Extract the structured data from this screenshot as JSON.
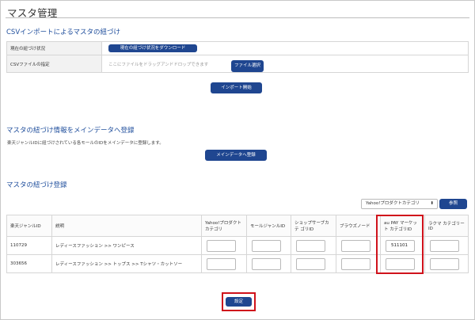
{
  "page": {
    "title": "マスタ管理"
  },
  "csv_section": {
    "title": "CSVインポートによるマスタの紐づけ",
    "status_label": "現在の紐づけ状況",
    "download_button": "現在の紐づけ状況をダウンロード",
    "file_label": "CSVファイルの指定",
    "dropzone_placeholder": "ここにファイルをドラッグアンドドロップできます",
    "file_button": "ファイル選択",
    "import_button": "インポート開始"
  },
  "main_data_section": {
    "title": "マスタの紐づけ情報をメインデータへ登録",
    "description": "楽天ジャンルIDに紐づけされている各モールのIDをメインデータに登録します。",
    "register_button": "メインデータへ登録"
  },
  "registration_section": {
    "title": "マスタの紐づけ登録",
    "category_select_value": "Yahoo!プロダクトカテゴリ",
    "reference_button": "参照",
    "columns": [
      "楽天ジャンルID",
      "説明",
      "Yahoo!プロダクト カテゴリ",
      "モールジャンルID",
      "ショップサーブカテ ゴリID",
      "ブラウズノード",
      "au PAY マーケット カテゴリID",
      "ラクマ カテゴリー ID"
    ],
    "rows": [
      {
        "genre_id": "110729",
        "description": "レディースファッション >> ワンピース",
        "yahoo": "",
        "mall": "",
        "shopserve": "",
        "browse": "",
        "aupay": "511101",
        "rakuma": ""
      },
      {
        "genre_id": "303656",
        "description": "レディースファッション >> トップス >> Tシャツ・カットソー",
        "yahoo": "",
        "mall": "",
        "shopserve": "",
        "browse": "",
        "aupay": "",
        "rakuma": ""
      }
    ],
    "submit_button": "設定"
  },
  "colors": {
    "accent": "#1f4690",
    "section_title": "#1f4e9c",
    "highlight": "#d0121b"
  }
}
